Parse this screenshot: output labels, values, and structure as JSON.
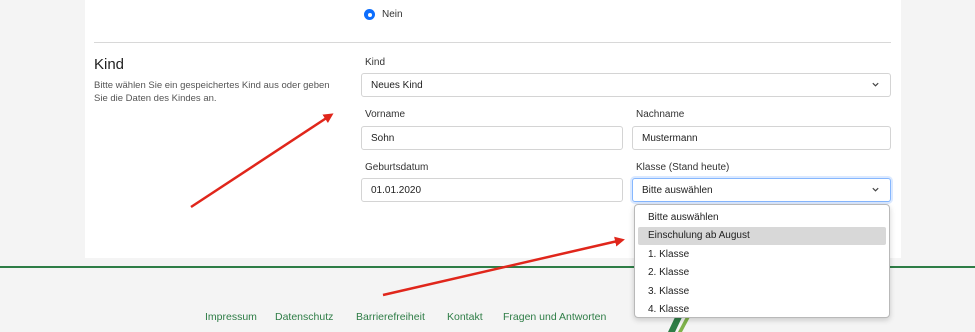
{
  "radio": {
    "label": "Nein",
    "checked": true
  },
  "section": {
    "title": "Kind",
    "description": "Bitte wählen Sie ein gespeichertes Kind aus oder geben Sie die Daten des Kindes an."
  },
  "form": {
    "kind_label": "Kind",
    "kind_value": "Neues Kind",
    "vorname_label": "Vorname",
    "vorname_value": "Sohn",
    "nachname_label": "Nachname",
    "nachname_value": "Mustermann",
    "geburtsdatum_label": "Geburtsdatum",
    "geburtsdatum_value": "01.01.2020",
    "klasse_label": "Klasse (Stand heute)",
    "klasse_value": "Bitte auswählen"
  },
  "dropdown": {
    "options": [
      "Bitte auswählen",
      "Einschulung ab August",
      "1. Klasse",
      "2. Klasse",
      "3. Klasse",
      "4. Klasse"
    ],
    "highlighted_index": 1
  },
  "footer": {
    "links": [
      "Impressum",
      "Datenschutz",
      "Barrierefreiheit",
      "Kontakt",
      "Fragen und Antworten"
    ]
  },
  "colors": {
    "accent": "#0d6efd",
    "footer_green": "#2e7d46",
    "annotation_arrow": "#e0261b"
  }
}
